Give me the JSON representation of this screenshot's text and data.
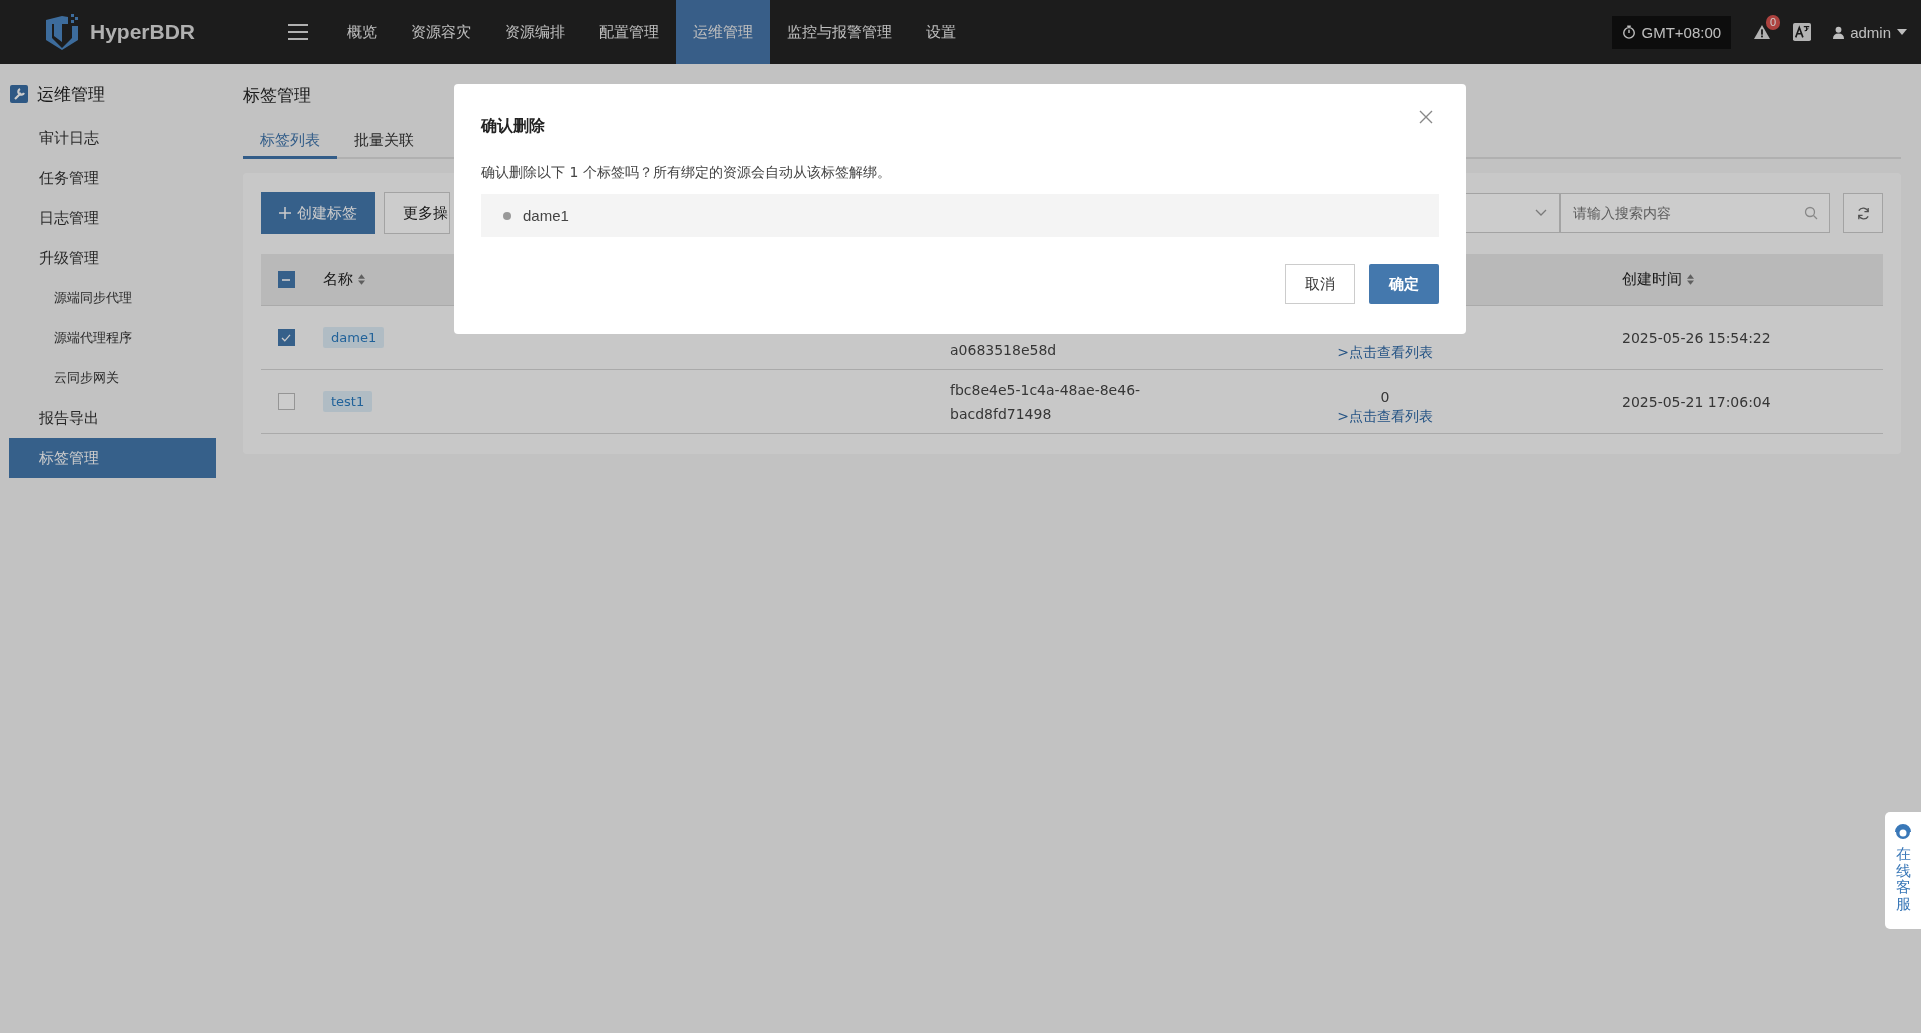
{
  "top_bar": {
    "logo": "HyperBDR",
    "nav": [
      {
        "label": "概览",
        "selected": false
      },
      {
        "label": "资源容灾",
        "selected": false
      },
      {
        "label": "资源编排",
        "selected": false
      },
      {
        "label": "配置管理",
        "selected": false
      },
      {
        "label": "运维管理",
        "selected": true
      },
      {
        "label": "监控与报警管理",
        "selected": false
      },
      {
        "label": "设置",
        "selected": false
      }
    ],
    "timezone": "GMT+08:00",
    "alert_count": "0",
    "user": "admin"
  },
  "sidebar": {
    "title": "运维管理",
    "items": [
      {
        "label": "审计日志",
        "selected": false
      },
      {
        "label": "任务管理",
        "selected": false
      },
      {
        "label": "日志管理",
        "selected": false
      },
      {
        "label": "升级管理",
        "selected": false,
        "children": [
          {
            "label": "源端同步代理",
            "selected": false
          },
          {
            "label": "源端代理程序",
            "selected": false
          },
          {
            "label": "云同步网关",
            "selected": false
          }
        ]
      },
      {
        "label": "报告导出",
        "selected": false
      },
      {
        "label": "标签管理",
        "selected": true
      }
    ]
  },
  "page": {
    "title": "标签管理",
    "tabs": [
      {
        "label": "标签列表",
        "selected": true
      },
      {
        "label": "批量关联",
        "selected": false
      }
    ],
    "toolbar": {
      "create_button": "创建标签",
      "more_button": "更多操",
      "search": {
        "placeholder": "请输入搜索内容"
      }
    },
    "table": {
      "select_all_indeterminate": true,
      "columns": [
        "名称",
        "创建时间"
      ],
      "rows": [
        {
          "checked": true,
          "name": "dame1",
          "id": "a0683518e58d",
          "link": ">点击查看列表",
          "created": "2025-05-26 15:54:22"
        },
        {
          "checked": false,
          "name": "test1",
          "id": "fbc8e4e5-1c4a-48ae-8e46-bacd8fd71498",
          "count": "0",
          "link": ">点击查看列表",
          "created": "2025-05-21 17:06:04"
        }
      ]
    }
  },
  "dialog": {
    "title": "确认删除",
    "message": "确认删除以下 1 个标签吗？所有绑定的资源会自动从该标签解绑。",
    "items": [
      "dame1"
    ],
    "cancel": "取消",
    "confirm": "确定"
  },
  "chat_widget": {
    "label": "在线客服"
  }
}
